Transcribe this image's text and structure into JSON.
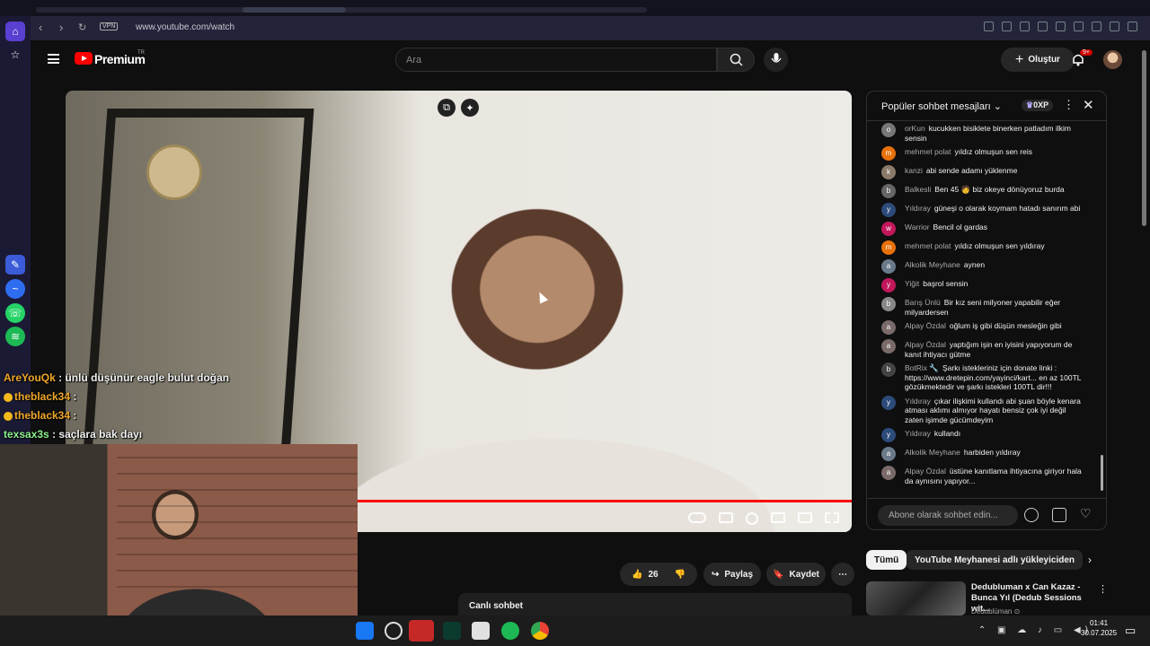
{
  "browser": {
    "url": "www.youtube.com/watch",
    "vpn_label": "VPN"
  },
  "yt_header": {
    "brand": "Premium",
    "country": "TR",
    "search_placeholder": "Ara",
    "create_label": "Oluştur",
    "notif_badge": "9+"
  },
  "overlay_chat": [
    {
      "user": "AreYouQk",
      "text": ": ünlü düşünür eagle bulut doğan",
      "badge": false,
      "color": "orange"
    },
    {
      "user": "theblack34",
      "text": ":",
      "badge": true,
      "color": "orange"
    },
    {
      "user": "theblack34",
      "text": ":",
      "badge": true,
      "color": "orange"
    },
    {
      "user": "texsax3s",
      "text": ": saçlara bak dayı",
      "badge": false,
      "color": "green"
    }
  ],
  "actions": {
    "like_count": "26",
    "share_label": "Paylaş",
    "save_label": "Kaydet",
    "more": "⋯"
  },
  "live_chat_strip": "Canlı sohbet",
  "chat": {
    "title": "Popüler sohbet mesajları",
    "xp": "0XP",
    "input_placeholder": "Abone olarak sohbet edin...",
    "messages": [
      {
        "author": "orKun",
        "text": "kucukken bisiklete binerken patladım ilkim sensin",
        "color": "#777"
      },
      {
        "author": "mehmet polat",
        "text": "yıldız olmuşun sen reis",
        "color": "#e8710a"
      },
      {
        "author": "kanzi",
        "text": "abi sende adamı yüklenme",
        "color": "#8a7a6a"
      },
      {
        "author": "Balkesli",
        "text": "Ben 45 🧑 biz okeye dönüyoruz burda",
        "color": "#666"
      },
      {
        "author": "Yıldıray",
        "text": "güneşi o olarak koymam hatadı sanırım abi",
        "color": "#2d4b7a"
      },
      {
        "author": "Warrior",
        "text": "Bencil ol gardas",
        "color": "#c2185b"
      },
      {
        "author": "mehmet polat",
        "text": "yıldız olmuşun sen yıldıray",
        "color": "#e8710a"
      },
      {
        "author": "Alkolik Meyhane",
        "text": "aynen",
        "color": "#6a7a8a"
      },
      {
        "author": "Yiğit",
        "text": "başrol sensin",
        "color": "#c2185b"
      },
      {
        "author": "Barış Ünlü",
        "text": "Bir kız seni milyoner yapabilir eğer milyardersen",
        "color": "#888"
      },
      {
        "author": "Alpay Özdal",
        "text": "oğlum iş gibi düşün mesleğin gibi",
        "color": "#7a6a6a"
      },
      {
        "author": "Alpay Özdal",
        "text": "yaptığım işin en iyisini yapıyorum de kanıt ihtiyacı gütme",
        "color": "#7a6a6a"
      },
      {
        "author": "BotRix 🔧",
        "text": "Şarkı istekleriniz için donate linki : https://www.dretepin.com/yayinci/kart... en az 100TL gözükmektedir ve şarkı istekleri 100TL dir!!!",
        "color": "#444"
      },
      {
        "author": "Yıldıray",
        "text": "çıkar ilişkimi kullandı abi şuan böyle kenara atması aklımı almıyor hayatı bensiz çok iyi değil zaten işimde gücümdeyim",
        "color": "#2d4b7a"
      },
      {
        "author": "Yıldıray",
        "text": "kullandı",
        "color": "#2d4b7a"
      },
      {
        "author": "Alkolik Meyhane",
        "text": "harbiden yıldıray",
        "color": "#6a7a8a"
      },
      {
        "author": "Alpay Özdal",
        "text": "üstüne kanıtlama ihtiyacına giriyor hala da aynısını yapıyor...",
        "color": "#7a6a6a"
      }
    ]
  },
  "filters": [
    "Tümü",
    "YouTube Meyhanesi adlı yükleyiciden"
  ],
  "recommendation": {
    "title": "Dedubluman x Can Kazaz - Bunca Yıl (Dedub Sessions wit...",
    "channel": "Dedublüman ⊙"
  },
  "taskbar": {
    "time": "01:41",
    "date": "30.07.2025"
  },
  "colors": {
    "accent_red": "#ff0000",
    "sidebar_bg": "#1b1a34",
    "page_bg": "#0f0f0f"
  }
}
